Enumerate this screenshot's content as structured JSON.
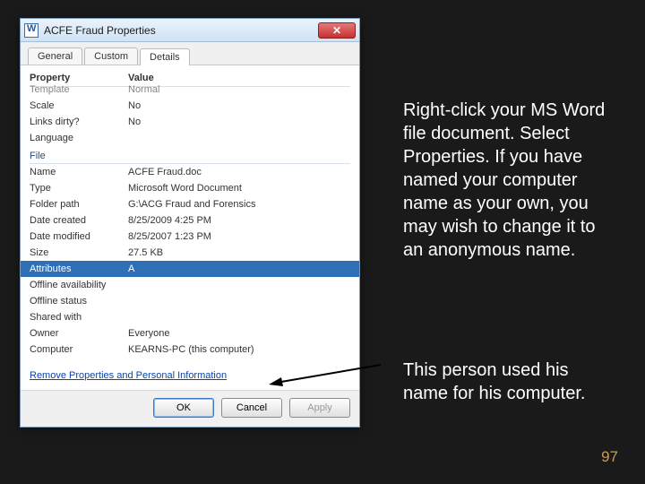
{
  "window": {
    "title": "ACFE Fraud Properties",
    "tabs": [
      "General",
      "Custom",
      "Details"
    ],
    "active_tab": 2,
    "columns": {
      "property": "Property",
      "value": "Value"
    },
    "top_rows": [
      {
        "property": "Template",
        "value": "Normal"
      },
      {
        "property": "Scale",
        "value": "No"
      },
      {
        "property": "Links dirty?",
        "value": "No"
      },
      {
        "property": "Language",
        "value": ""
      }
    ],
    "group_file": "File",
    "file_rows": [
      {
        "property": "Name",
        "value": "ACFE Fraud.doc"
      },
      {
        "property": "Type",
        "value": "Microsoft Word Document"
      },
      {
        "property": "Folder path",
        "value": "G:\\ACG Fraud and Forensics"
      },
      {
        "property": "Date created",
        "value": "8/25/2009 4:25 PM"
      },
      {
        "property": "Date modified",
        "value": "8/25/2007 1:23 PM"
      },
      {
        "property": "Size",
        "value": "27.5 KB"
      },
      {
        "property": "Attributes",
        "value": "A",
        "selected": true
      },
      {
        "property": "Offline availability",
        "value": ""
      },
      {
        "property": "Offline status",
        "value": ""
      },
      {
        "property": "Shared with",
        "value": ""
      },
      {
        "property": "Owner",
        "value": "Everyone"
      },
      {
        "property": "Computer",
        "value": "KEARNS-PC (this computer)"
      }
    ],
    "link": "Remove Properties and Personal Information",
    "buttons": {
      "ok": "OK",
      "cancel": "Cancel",
      "apply": "Apply"
    }
  },
  "annotations": {
    "note1": "Right-click your MS Word file document. Select Properties. If you  have named your computer name as your own, you may wish to change it to an anonymous name.",
    "note2": "This person used his name for his computer.",
    "page": "97"
  }
}
